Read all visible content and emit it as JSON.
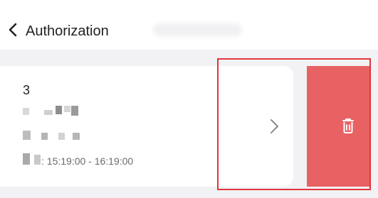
{
  "header": {
    "back_icon": "chevron-left-icon",
    "title": "Authorization"
  },
  "item": {
    "number": "3",
    "time_text": ": 15:19:00 - 16:19:00",
    "detail_icon": "chevron-right-icon"
  },
  "actions": {
    "delete_icon": "trash-icon",
    "delete_color": "#E86264"
  },
  "colors": {
    "highlight": "#E0353D",
    "background": "#F2F2F4"
  }
}
